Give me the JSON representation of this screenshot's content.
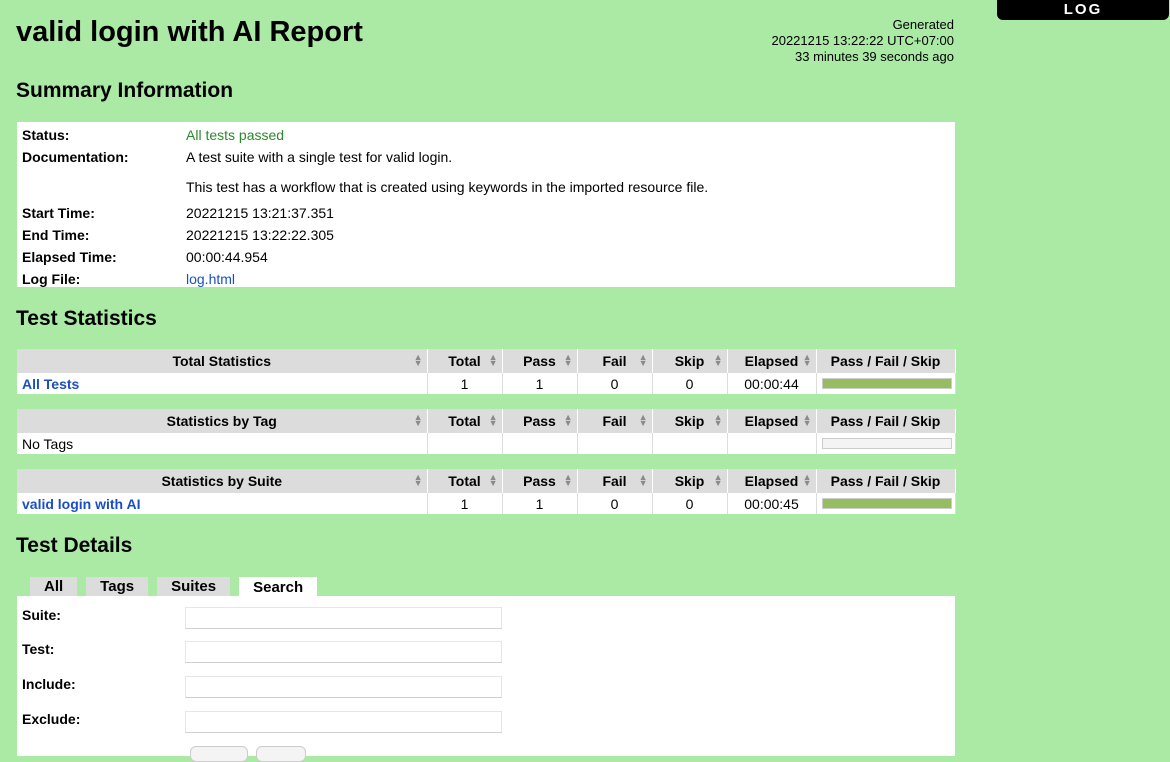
{
  "header": {
    "log_button": "LOG",
    "title": "valid login with AI Report",
    "generated_label": "Generated",
    "generated_time": "20221215 13:22:22 UTC+07:00",
    "generated_ago": "33 minutes 39 seconds ago"
  },
  "summary": {
    "heading": "Summary Information",
    "status_label": "Status:",
    "status_value": "All tests passed",
    "doc_label": "Documentation:",
    "doc_line1": "A test suite with a single test for valid login.",
    "doc_line2": "This test has a workflow that is created using keywords in the imported resource file.",
    "start_label": "Start Time:",
    "start_value": "20221215 13:21:37.351",
    "end_label": "End Time:",
    "end_value": "20221215 13:22:22.305",
    "elapsed_label": "Elapsed Time:",
    "elapsed_value": "00:00:44.954",
    "log_label": "Log File:",
    "log_value": "log.html"
  },
  "statistics": {
    "heading": "Test Statistics",
    "columns": [
      "Total",
      "Pass",
      "Fail",
      "Skip",
      "Elapsed",
      "Pass / Fail / Skip"
    ],
    "total": {
      "title": "Total Statistics",
      "row": {
        "name": "All Tests",
        "total": "1",
        "pass": "1",
        "fail": "0",
        "skip": "0",
        "elapsed": "00:00:44",
        "pass_fraction": 1
      }
    },
    "tag": {
      "title": "Statistics by Tag",
      "row": {
        "name": "No Tags",
        "total": "",
        "pass": "",
        "fail": "",
        "skip": "",
        "elapsed": "",
        "pass_fraction": 0
      }
    },
    "suite": {
      "title": "Statistics by Suite",
      "row": {
        "name": "valid login with AI",
        "total": "1",
        "pass": "1",
        "fail": "0",
        "skip": "0",
        "elapsed": "00:00:45",
        "pass_fraction": 1
      }
    }
  },
  "details": {
    "heading": "Test Details",
    "tabs": [
      "All",
      "Tags",
      "Suites",
      "Search"
    ],
    "active_tab": "Search",
    "search": {
      "suite_label": "Suite:",
      "test_label": "Test:",
      "include_label": "Include:",
      "exclude_label": "Exclude:"
    }
  },
  "colors": {
    "background": "#abeaa5",
    "pass_bar": "#97bd61",
    "link": "#1a4fc4",
    "pass_text": "#2b8a2b"
  }
}
